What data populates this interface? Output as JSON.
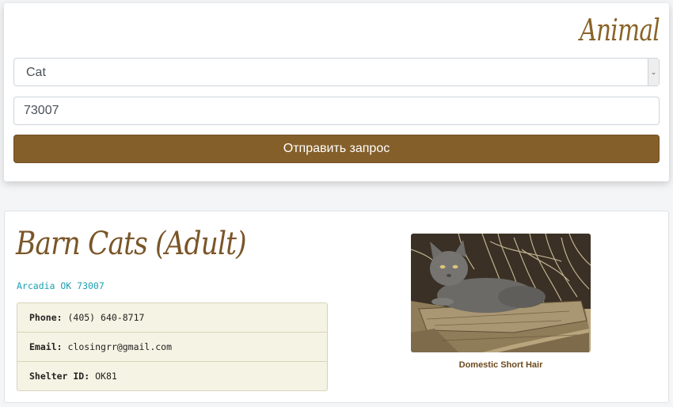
{
  "header": {
    "brand": "Animal"
  },
  "search": {
    "animal_selected": "Cat",
    "zip_value": "73007",
    "submit_label": "Отправить запрос"
  },
  "result": {
    "name": "Barn Cats (Adult)",
    "location": "Arcadia OK 73007",
    "info": [
      {
        "label": "Phone:",
        "value": "(405) 640-8717"
      },
      {
        "label": "Email:",
        "value": "closingrr@gmail.com"
      },
      {
        "label": "Shelter ID:",
        "value": "OK81"
      }
    ],
    "breed": "Domestic Short Hair"
  },
  "colors": {
    "accent": "#855f2a",
    "link": "#1aa0b0",
    "info_bg": "#f5f3e3"
  }
}
